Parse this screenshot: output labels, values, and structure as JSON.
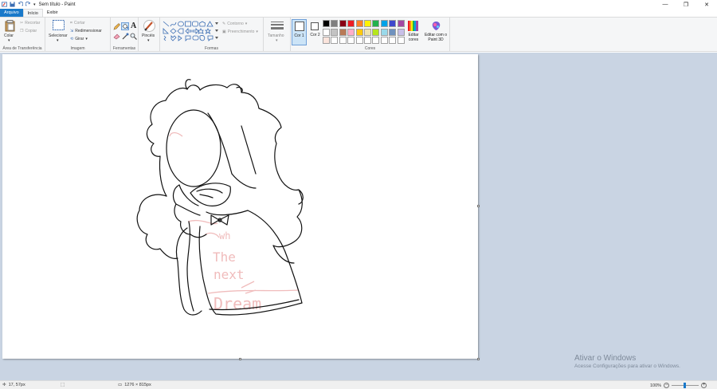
{
  "window": {
    "title": "Sem título - Paint",
    "minimize": "—",
    "maximize": "❐",
    "close": "✕"
  },
  "tabs": [
    {
      "label": "Arquivo"
    },
    {
      "label": "Início"
    },
    {
      "label": "Exibir"
    }
  ],
  "ribbon": {
    "clipboard": {
      "paste": "Colar",
      "cut": "Recortar",
      "copy": "Copiar",
      "label": "Área de Transferência"
    },
    "image": {
      "select": "Selecionar",
      "crop": "Cortar",
      "resize": "Redimensionar",
      "rotate": "Girar",
      "label": "Imagem"
    },
    "tools": {
      "label": "Ferramentas"
    },
    "brushes": {
      "label": "Pincéis"
    },
    "shapes": {
      "outline": "Contorno",
      "fill": "Preenchimento",
      "label": "Formas"
    },
    "size": {
      "label": "Tamanho"
    },
    "colors": {
      "color1": "Cor 1",
      "color2": "Cor 2",
      "edit": "Editar cores",
      "paint3d": "Editar com o Paint 3D",
      "label": "Cores",
      "palette_row1": [
        "#000000",
        "#7f7f7f",
        "#880015",
        "#ed1c24",
        "#ff7f27",
        "#fff200",
        "#22b14c",
        "#00a2e8",
        "#3f48cc",
        "#a349a4"
      ],
      "palette_row2": [
        "#ffffff",
        "#c3c3c3",
        "#b97a57",
        "#ffaec9",
        "#ffc90e",
        "#efe4b0",
        "#b5e61d",
        "#99d9ea",
        "#7092be",
        "#c8bfe7"
      ],
      "palette_row3": [
        "#fbe4dc",
        "#ffffff",
        "#ffffff",
        "#ffffff",
        "#ffffff",
        "#ffffff",
        "#ffffff",
        "#ffffff",
        "#ffffff",
        "#ffffff"
      ]
    }
  },
  "canvas": {
    "drawing_text": [
      "wh",
      "The",
      "next",
      "Dream"
    ]
  },
  "watermark": {
    "line1": "Ativar o Windows",
    "line2": "Acesse Configurações para ativar o Windows."
  },
  "status": {
    "cursor_pos": "17, 57px",
    "canvas_size": "1276 × 815px",
    "zoom": "100%"
  }
}
